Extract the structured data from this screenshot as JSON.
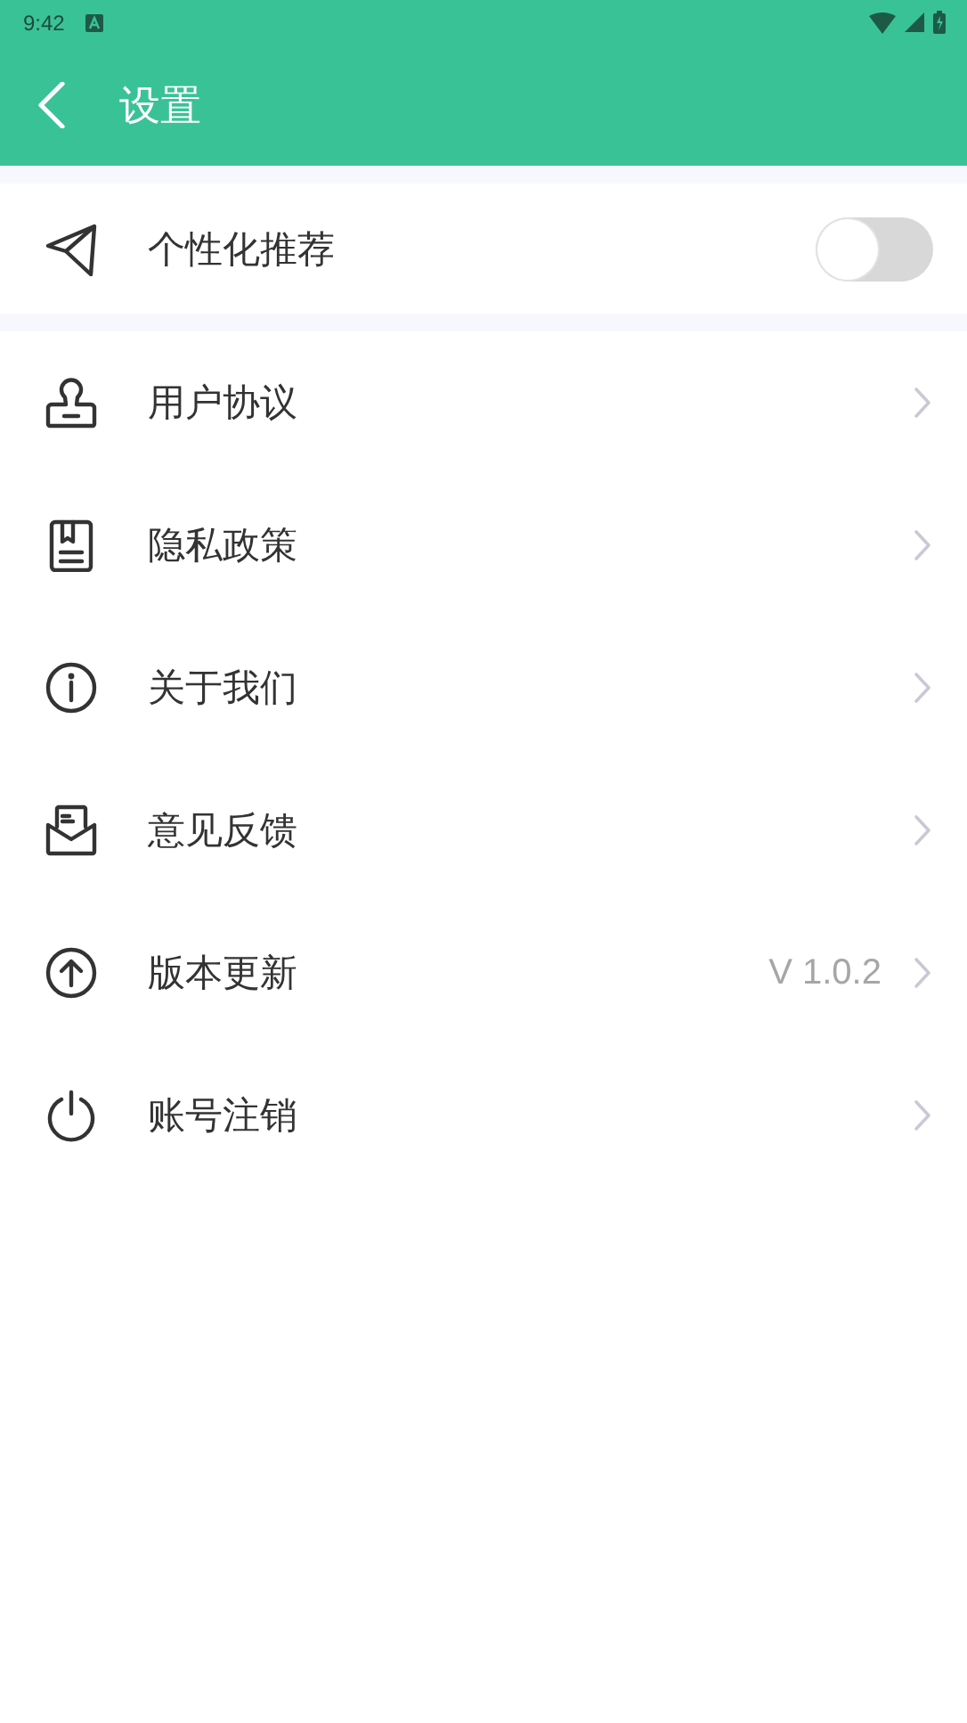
{
  "status_bar": {
    "time": "9:42"
  },
  "app_bar": {
    "title": "设置"
  },
  "toggle_row": {
    "label": "个性化推荐",
    "on": false
  },
  "items": [
    {
      "label": "用户协议"
    },
    {
      "label": "隐私政策"
    },
    {
      "label": "关于我们"
    },
    {
      "label": "意见反馈"
    },
    {
      "label": "版本更新",
      "value": "V 1.0.2"
    },
    {
      "label": "账号注销"
    }
  ]
}
